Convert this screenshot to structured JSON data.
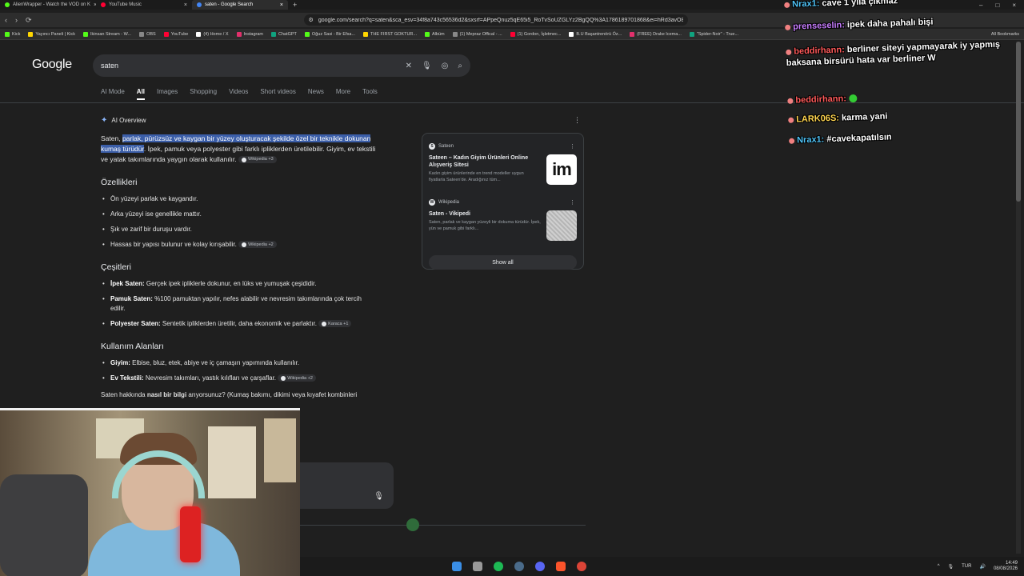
{
  "browser": {
    "tabs": [
      {
        "label": "AlienWrapper - Watch the VOD on K",
        "color": "#53fc18"
      },
      {
        "label": "YouTube Music",
        "color": "#ff0033"
      },
      {
        "label": "saten - Google Search",
        "color": "#4285f4"
      }
    ],
    "url": "google.com/search?q=saten&sca_esv=34f8a743c56536d2&sxsrf=APpeQnuz5qE65i5_RoTvSoUZGLYz2BgQQ%3A1786189701868&ei=hRd3avO8NP...",
    "bookmarks": [
      "Kick",
      "Yayıncı Paneli | Kick",
      "Ikinsan Stream - W...",
      "OBS",
      "YouTube",
      "(4) Home / X",
      "Instagram",
      "ChatGPT",
      "Oğuz Sasi - Bir Efsa...",
      "THE FIRST GOKTUR...",
      "Albüm",
      "(1) Mepraz Offical - ...",
      "(1) Gordon, İşletmec...",
      "B.U Başantrenörü Öz...",
      "(FREE) Drake Icema...",
      "\"Spider-Noir\" - True..."
    ],
    "all_bookmarks": "All Bookmarks"
  },
  "google": {
    "logo": "Google",
    "query": "saten",
    "tabs": [
      "AI Mode",
      "All",
      "Images",
      "Shopping",
      "Videos",
      "Short videos",
      "News",
      "More",
      "Tools"
    ],
    "active_tab": "All"
  },
  "overview": {
    "header": "AI Overview",
    "intro_plain": "Saten, ",
    "intro_highlight": "parlak, pürüzsüz ve kaygan bir yüzey oluşturacak şekilde özel bir teknikle dokunan kumaş türüdür",
    "intro_rest": ". İpek, pamuk veya polyester gibi farklı ipliklerden üretilebilir. Giyim, ev tekstili ve yatak takımlarında yaygın olarak kullanılır.",
    "intro_chip": "Wikipedia +3",
    "sections": [
      {
        "title": "Özellikleri",
        "items": [
          {
            "bold": "",
            "text": "Ön yüzeyi parlak ve kaygandır.",
            "chip": ""
          },
          {
            "bold": "",
            "text": "Arka yüzeyi ise genellikle mattır.",
            "chip": ""
          },
          {
            "bold": "",
            "text": "Şık ve zarif bir duruşu vardır.",
            "chip": ""
          },
          {
            "bold": "",
            "text": "Hassas bir yapısı bulunur ve kolay kırışabilir.",
            "chip": "Wikipedia +2"
          }
        ]
      },
      {
        "title": "Çeşitleri",
        "items": [
          {
            "bold": "İpek Saten:",
            "text": " Gerçek ipek ipliklerle dokunur, en lüks ve yumuşak çeşididir.",
            "chip": ""
          },
          {
            "bold": "Pamuk Saten:",
            "text": " %100 pamuktan yapılır, nefes alabilir ve nevresim takımlarında çok tercih edilir.",
            "chip": ""
          },
          {
            "bold": "Polyester Saten:",
            "text": " Sentetik ipliklerden üretilir, daha ekonomik ve parlaktır.",
            "chip": "Karaca +1"
          }
        ]
      },
      {
        "title": "Kullanım Alanları",
        "items": [
          {
            "bold": "Giyim:",
            "text": " Elbise, bluz, etek, abiye ve iç çamaşırı yapımında kullanılır.",
            "chip": ""
          },
          {
            "bold": "Ev Tekstili:",
            "text": " Nevresim takımları, yastık kılıfları ve çarşaflar.",
            "chip": "Wikipedia +2"
          }
        ]
      }
    ],
    "tail_pre": "Saten hakkında ",
    "tail_bold": "nasıl bir bilgi",
    "tail_post": " arıyorsunuz? (Kumaş bakımı, dikimi veya kıyafet kombinleri"
  },
  "sources": [
    {
      "site": "Sateen",
      "title": "Sateen – Kadın Giyim Ürünleri Online Alışveriş Sitesi",
      "snippet": "Kadın giyim ürünlerinde en trend modeller uygun fiyatlarla Sateen'de. Aradığınız tüm...",
      "thumb_text": "im"
    },
    {
      "site": "Wikipedia",
      "title": "Saten - Vikipedi",
      "snippet": "Saten, parlak ve kaygan yüzeyli bir dokuma türüdür. İpek, yün ve pamuk gibi farklı...",
      "thumb_text": ""
    }
  ],
  "show_all": "Show all",
  "chat": [
    {
      "user": "Nrax1:",
      "text": "cave 1 yıla çıkmaz",
      "color": "#4fc3f7"
    },
    {
      "user": "prenseselin:",
      "text": "ipek daha pahalı bişi",
      "color": "#c77dff"
    },
    {
      "user": "beddirhann:",
      "text": "berliner siteyi yapmayarak iy yapmış baksana birsürü hata var berliner W",
      "color": "#ff5a5a"
    },
    {
      "user": "beddirhann:",
      "text": "",
      "color": "#ff5a5a"
    },
    {
      "user": "LARK06S:",
      "text": "karma yani",
      "color": "#ffd54f"
    },
    {
      "user": "Nrax1:",
      "text": "#cavekapatılsın",
      "color": "#4fc3f7"
    }
  ],
  "taskbar": {
    "lang": "TUR",
    "time": "14:49",
    "date": "08/08/2026"
  }
}
